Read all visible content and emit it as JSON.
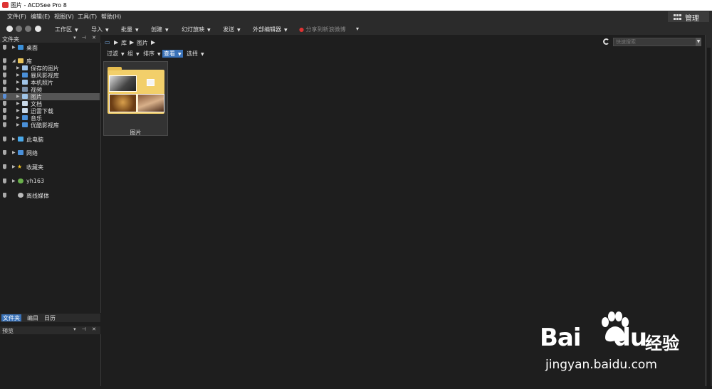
{
  "window": {
    "title": "图片 - ACDSee Pro 8"
  },
  "menu": [
    {
      "label": "文件(F)"
    },
    {
      "label": "编辑(E)"
    },
    {
      "label": "视图(V)"
    },
    {
      "label": "工具(T)"
    },
    {
      "label": "帮助(H)"
    }
  ],
  "manage_button": {
    "label": "管理"
  },
  "toolbar": {
    "items": [
      "工作区",
      "导入",
      "批量",
      "创建",
      "幻灯放映",
      "发送",
      "外部编辑器"
    ],
    "share": "分享到新浪微博"
  },
  "folder_panel": {
    "title": "文件夹"
  },
  "tree": [
    {
      "label": "桌面",
      "icon": "desktop-icon",
      "color": "#3a8fd8"
    },
    {
      "label": "库",
      "icon": "library-folder-icon",
      "color": "#e8c35a"
    },
    {
      "label": "保存的图片",
      "icon": "picture-icon",
      "color": "#9fc4e8"
    },
    {
      "label": "暴风影视库",
      "icon": "video-library-icon",
      "color": "#4a90d9"
    },
    {
      "label": "本机照片",
      "icon": "picture-icon",
      "color": "#9fc4e8"
    },
    {
      "label": "视频",
      "icon": "video-icon",
      "color": "#7a8fa8"
    },
    {
      "label": "图片",
      "icon": "picture-icon",
      "color": "#9fc4e8"
    },
    {
      "label": "文档",
      "icon": "document-icon",
      "color": "#c8d8e8"
    },
    {
      "label": "迅雷下载",
      "icon": "download-icon",
      "color": "#c8d8e8"
    },
    {
      "label": "音乐",
      "icon": "music-icon",
      "color": "#4a90d9"
    },
    {
      "label": "优酷影视库",
      "icon": "video-library-icon",
      "color": "#4a90d9"
    },
    {
      "label": "此电脑",
      "icon": "computer-icon",
      "color": "#4aa8e8"
    },
    {
      "label": "网络",
      "icon": "network-icon",
      "color": "#4a90d9"
    },
    {
      "label": "收藏夹",
      "icon": "star-icon",
      "color": "#f0c020"
    },
    {
      "label": "yh163",
      "icon": "user-icon",
      "color": "#6ab04c"
    },
    {
      "label": "离线媒体",
      "icon": "offline-media-icon",
      "color": "#bbbbbb"
    }
  ],
  "left_tabs": [
    "文件夹",
    "编目",
    "日历"
  ],
  "preview_panel": {
    "title": "预览"
  },
  "path": [
    "库",
    "图片"
  ],
  "search": {
    "placeholder": "快速搜索"
  },
  "filterbar": [
    "过滤",
    "组",
    "排序",
    "查看",
    "选择"
  ],
  "thumbnail": {
    "label": "图片"
  },
  "watermark": {
    "brand": "Bai",
    "brand2": "du",
    "jingyan": "经验",
    "url": "jingyan.baidu.com"
  },
  "colors": {
    "accent": "#3a72b8",
    "panel": "#2b2b2b",
    "background": "#1e1e1e"
  }
}
